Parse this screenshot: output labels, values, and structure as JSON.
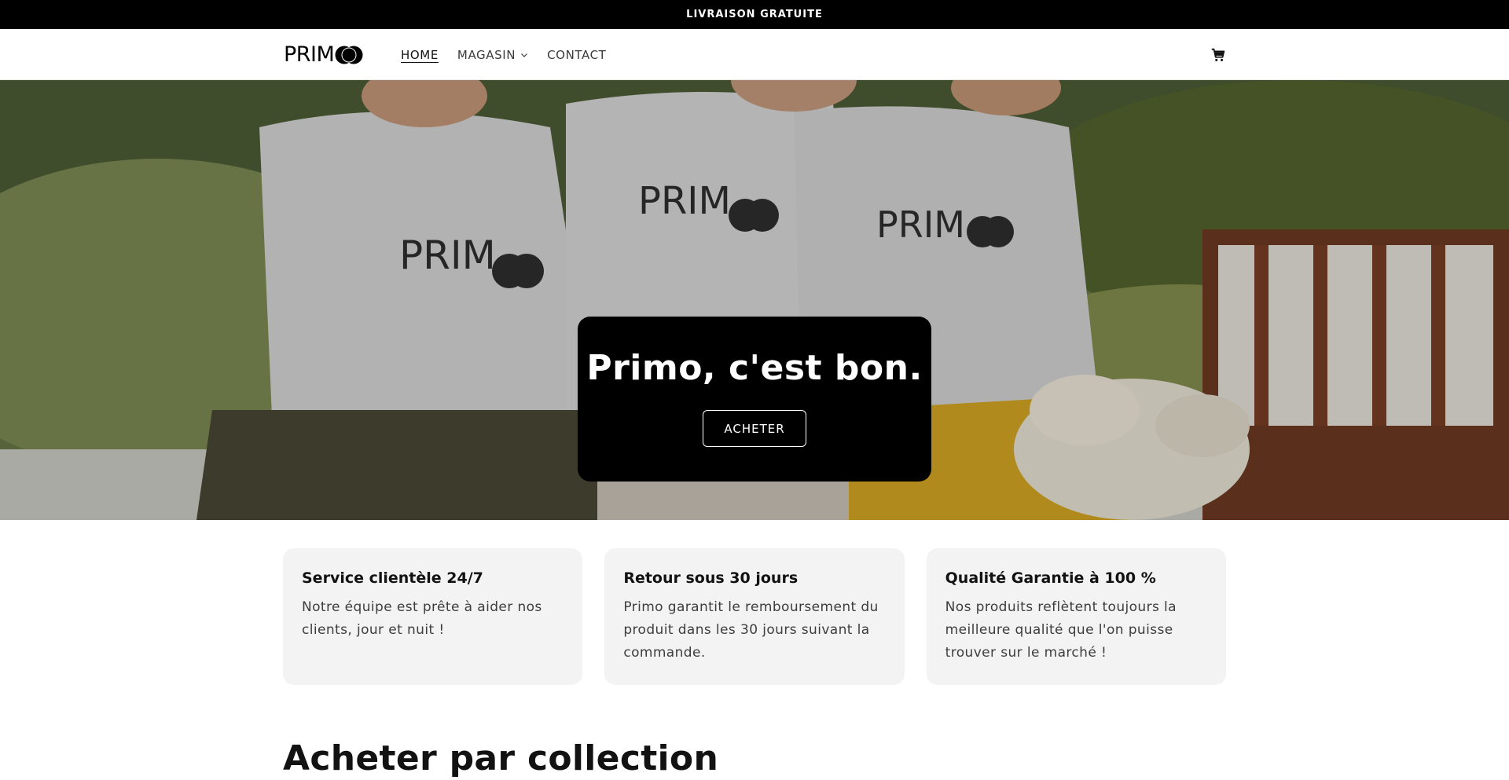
{
  "announcement": {
    "text": "LIVRAISON GRATUITE"
  },
  "header": {
    "logo": {
      "text": "PRIM",
      "icon": "double-circle-logo"
    },
    "nav": [
      {
        "label": "HOME",
        "active": true
      },
      {
        "label": "MAGASIN",
        "has_dropdown": true
      },
      {
        "label": "CONTACT"
      }
    ],
    "cart_icon": "cart-icon"
  },
  "hero": {
    "title": "Primo, c'est bon.",
    "button_label": "ACHETER",
    "shirt_logo_text": "PRIM"
  },
  "features": [
    {
      "title": "Service clientèle 24/7",
      "text": "Notre équipe est prête à aider nos clients, jour et nuit !"
    },
    {
      "title": "Retour sous 30 jours",
      "text": "Primo garantit le remboursement du produit dans les 30 jours suivant la commande."
    },
    {
      "title": "Qualité Garantie à 100 %",
      "text": "Nos produits reflètent toujours la meilleure qualité que l'on puisse trouver sur le marché !"
    }
  ],
  "collection": {
    "title": "Acheter par collection"
  },
  "colors": {
    "brand_black": "#000000",
    "card_bg": "#f3f3f3",
    "accent_white": "#ffffff"
  }
}
